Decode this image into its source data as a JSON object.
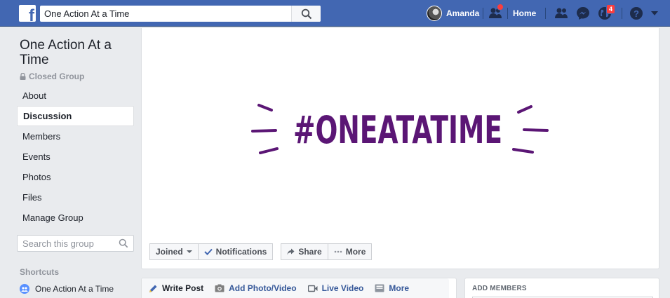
{
  "topbar": {
    "logo": "f",
    "search_value": "One Action At a Time",
    "user_name": "Amanda",
    "home_label": "Home",
    "notifications_count": "4",
    "icons": [
      "search-icon",
      "friend-requests-icon",
      "messenger-icon",
      "globe-icon",
      "help-icon",
      "caret-down-icon"
    ]
  },
  "sidebar": {
    "group_title": "One Action At a Time",
    "privacy": "Closed Group",
    "items": [
      {
        "label": "About",
        "active": false
      },
      {
        "label": "Discussion",
        "active": true
      },
      {
        "label": "Members",
        "active": false
      },
      {
        "label": "Events",
        "active": false
      },
      {
        "label": "Photos",
        "active": false
      },
      {
        "label": "Files",
        "active": false
      },
      {
        "label": "Manage Group",
        "active": false
      }
    ],
    "search_placeholder": "Search this group",
    "shortcuts_heading": "Shortcuts",
    "shortcut_label": "One Action At a Time"
  },
  "cover": {
    "hashtag": "#ONEATATIME",
    "hashtag_color": "#5b1675",
    "buttons": {
      "joined": "Joined",
      "notifications": "Notifications",
      "share": "Share",
      "more": "More"
    }
  },
  "composer": {
    "tabs": [
      "Write Post",
      "Add Photo/Video",
      "Live Video",
      "More"
    ]
  },
  "add_members": {
    "heading": "ADD MEMBERS"
  },
  "colors": {
    "brand": "#4267b2",
    "link": "#365899",
    "background": "#e9ebee"
  }
}
